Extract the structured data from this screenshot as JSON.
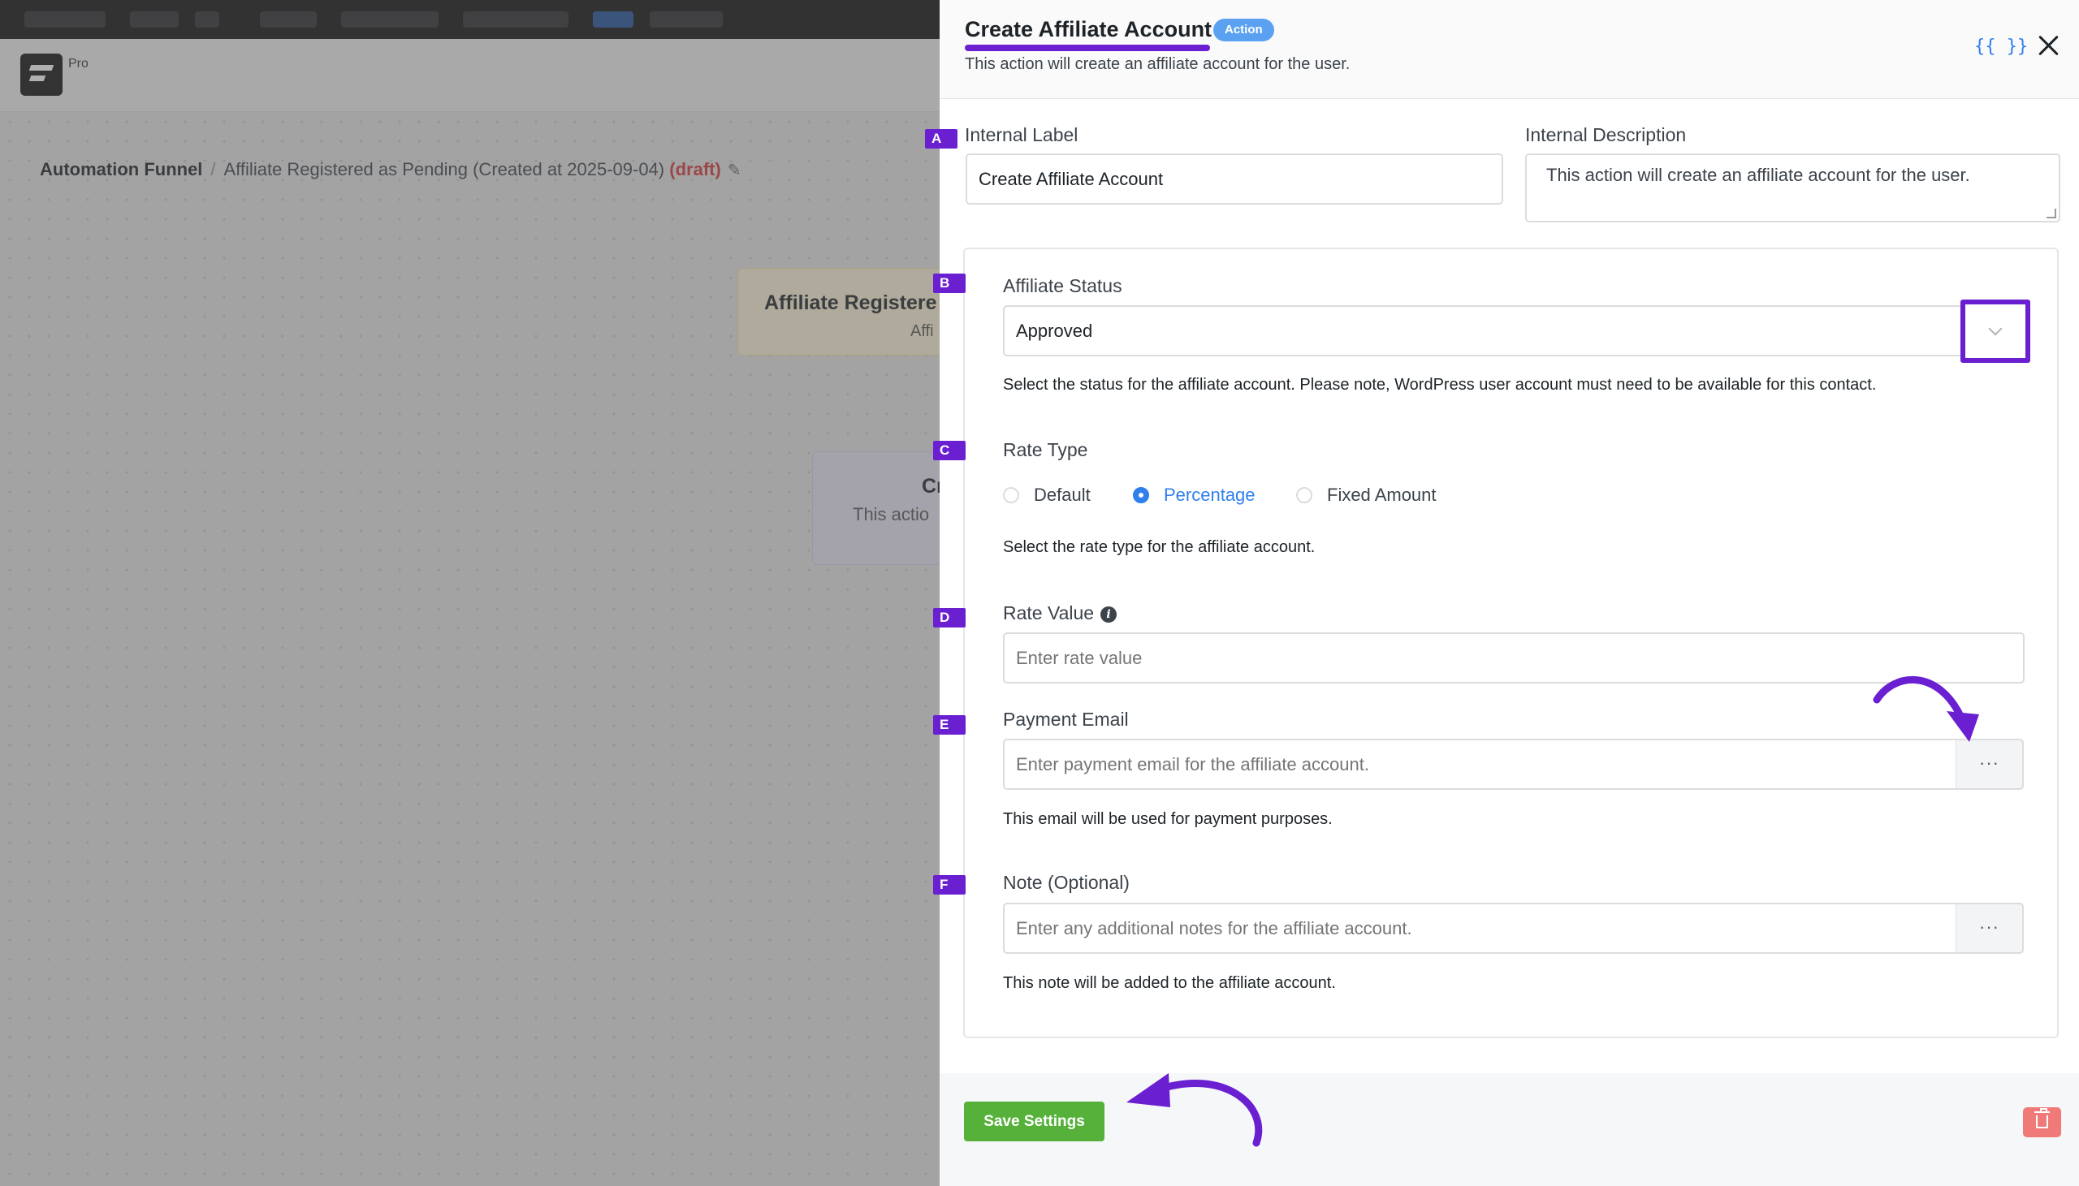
{
  "background": {
    "badge": "Pro",
    "breadcrumb": {
      "root": "Automation Funnel",
      "separator": "/",
      "title": "Affiliate Registered as Pending (Created at 2025-09-04)",
      "status": "(draft)"
    },
    "nodes": [
      {
        "title": "Affiliate Registere",
        "subtitle": "Affi"
      },
      {
        "title": "Cr",
        "subtitle": "This actio"
      }
    ]
  },
  "drawer": {
    "title": "Create Affiliate Account",
    "badge": "Action",
    "subtitle": "This action will create an affiliate account for the user.",
    "vars_icon": "{{ }}"
  },
  "fields": {
    "internal_label": {
      "marker": "A",
      "label": "Internal Label",
      "value": "Create Affiliate Account"
    },
    "internal_description": {
      "label": "Internal Description",
      "value": "This action will create an affiliate account for the user."
    },
    "affiliate_status": {
      "marker": "B",
      "label": "Affiliate Status",
      "value": "Approved",
      "help": "Select the status for the affiliate account. Please note, WordPress user account must need to be available for this contact."
    },
    "rate_type": {
      "marker": "C",
      "label": "Rate Type",
      "options": [
        "Default",
        "Percentage",
        "Fixed Amount"
      ],
      "selected": "Percentage",
      "help": "Select the rate type for the affiliate account."
    },
    "rate_value": {
      "marker": "D",
      "label": "Rate Value",
      "placeholder": "Enter rate value"
    },
    "payment_email": {
      "marker": "E",
      "label": "Payment Email",
      "placeholder": "Enter payment email for the affiliate account.",
      "more": "···",
      "help": "This email will be used for payment purposes."
    },
    "note": {
      "marker": "F",
      "label": "Note (Optional)",
      "placeholder": "Enter any additional notes for the affiliate account.",
      "more": "···",
      "help": "This note will be added to the affiliate account."
    }
  },
  "footer": {
    "save_label": "Save Settings"
  },
  "colors": {
    "accent": "#6a1fd1",
    "primary": "#2f80ed",
    "success": "#56b13b",
    "danger": "#f07a78",
    "draft": "#d63638"
  }
}
